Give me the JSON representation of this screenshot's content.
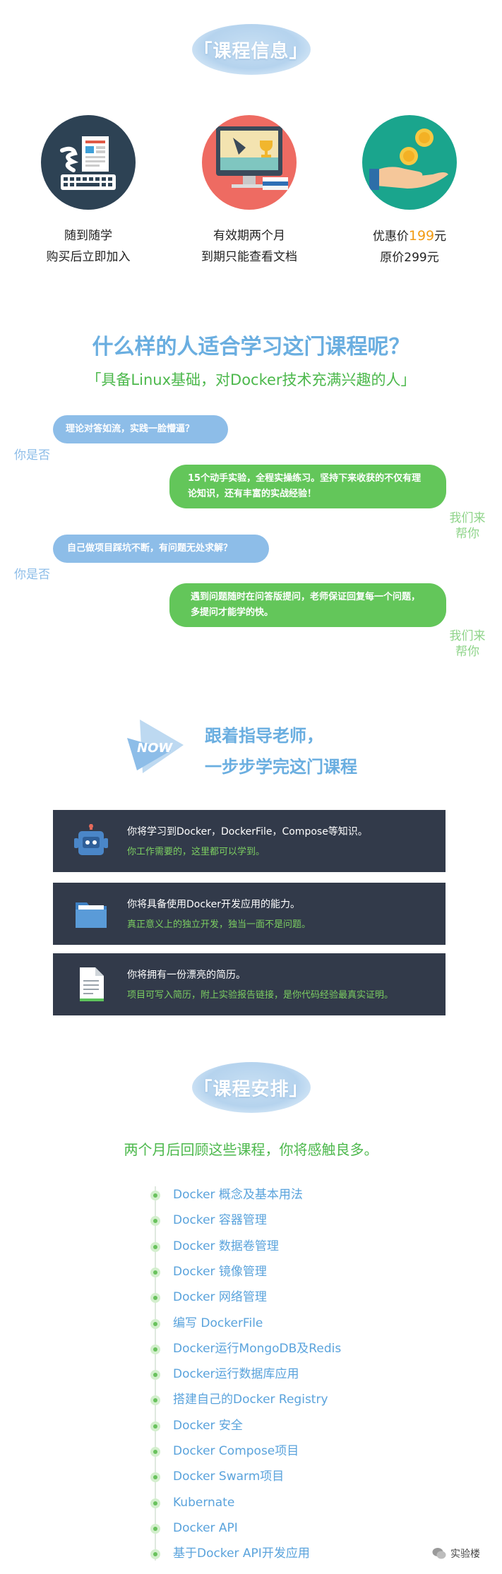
{
  "course_info": {
    "title": "「课程信息」",
    "items": [
      {
        "line1": "随到随学",
        "line2": "购买后立即加入"
      },
      {
        "line1": "有效期两个月",
        "line2": "到期只能查看文档"
      },
      {
        "price_prefix": "优惠价",
        "price_value": "199",
        "price_suffix": "元",
        "line2": "原价299元"
      }
    ]
  },
  "audience": {
    "title": "什么样的人适合学习这门课程呢？",
    "subtitle": "「具备Linux基础，对Docker技术充满兴趣的人」",
    "chat": [
      {
        "question": "理论对答如流，实践一脸懵逼？",
        "who": "你是否"
      },
      {
        "answer": "15个动手实验，全程实操练习。坚持下来收获的不仅有理论知识，还有丰富的实战经验！",
        "who_line1": "我们来",
        "who_line2": "帮你"
      },
      {
        "question": "自己做项目踩坑不断，有问题无处求解？",
        "who": "你是否"
      },
      {
        "answer": "遇到问题随时在问答版提问，老师保证回复每一个问题，多提问才能学的快。",
        "who_line1": "我们来",
        "who_line2": "帮你"
      }
    ]
  },
  "guide": {
    "badge": "NOW",
    "line1": "跟着指导老师，",
    "line2": "一步步学完这门课程",
    "features": [
      {
        "icon": "robot-icon",
        "title": "你将学习到Docker，DockerFile，Compose等知识。",
        "desc": "你工作需要的，这里都可以学到。"
      },
      {
        "icon": "folder-icon",
        "title": "你将具备使用Docker开发应用的能力。",
        "desc": "真正意义上的独立开发，独当一面不是问题。"
      },
      {
        "icon": "document-icon",
        "title": "你将拥有一份漂亮的简历。",
        "desc": "项目可写入简历，附上实验报告链接，是你代码经验最真实证明。"
      }
    ]
  },
  "schedule": {
    "title": "「课程安排」",
    "subtitle": "两个月后回顾这些课程，你将感触良多。",
    "items": [
      "Docker 概念及基本用法",
      "Docker 容器管理",
      "Docker 数据卷管理",
      "Docker 镜像管理",
      "Docker 网络管理",
      "编写 DockerFile",
      "Docker运行MongoDB及Redis",
      "Docker运行数据库应用",
      "搭建自己的Docker Registry",
      "Docker 安全",
      "Docker Compose项目",
      "Docker Swarm项目",
      "Kubernate",
      "Docker API",
      "基于Docker API开发应用"
    ]
  },
  "watermark": "实验楼",
  "colors": {
    "blue": "#6aaee0",
    "green": "#63c65a",
    "orange": "#f29b12",
    "dark_panel": "#323a4a"
  }
}
